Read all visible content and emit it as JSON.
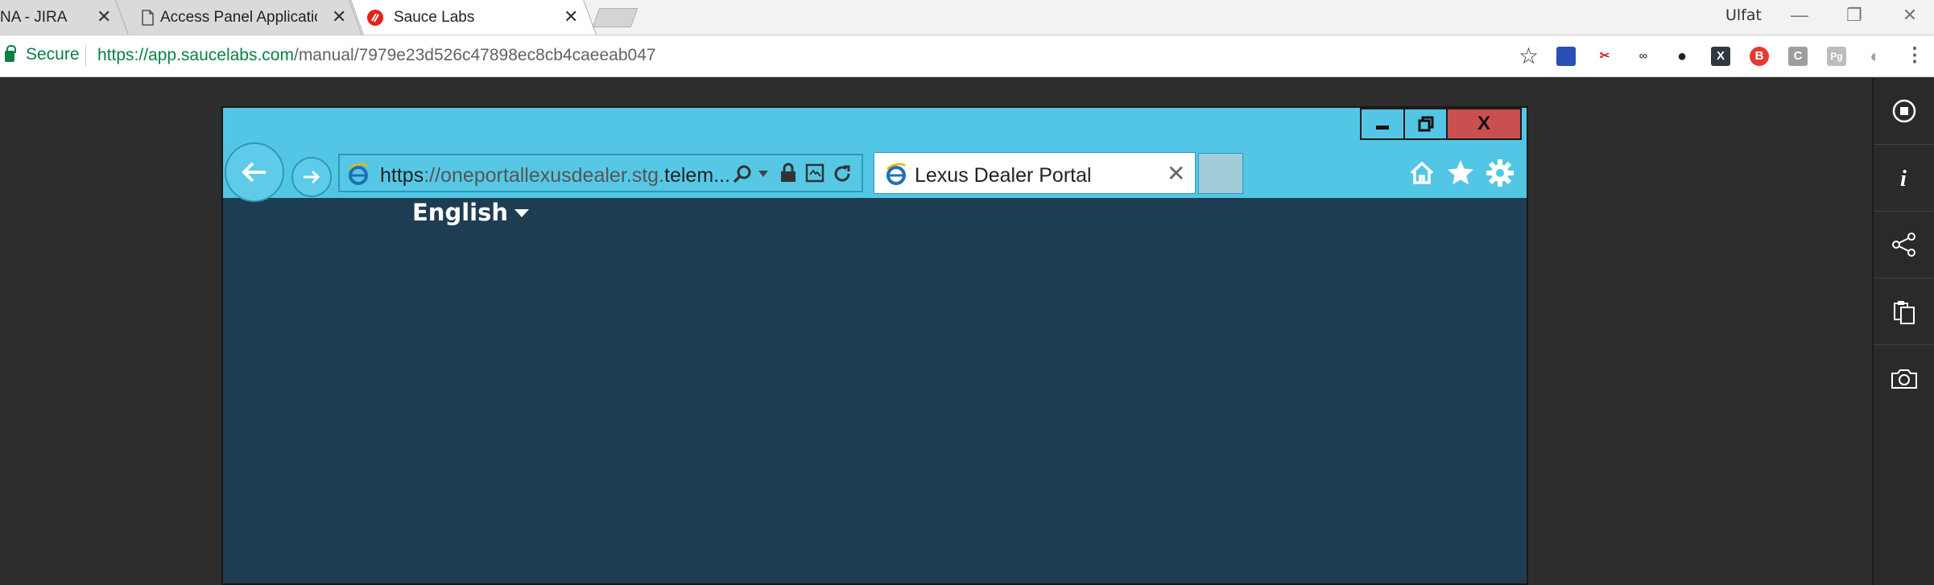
{
  "browser": {
    "tabs": [
      {
        "title": "NA - JIRA",
        "close": "✕"
      },
      {
        "title": "Access Panel Applications",
        "close": "✕"
      },
      {
        "title": "Sauce Labs",
        "close": "✕",
        "active": true
      }
    ],
    "user_name": "Ulfat",
    "window_controls": {
      "minimize": "—",
      "restore": "❐",
      "close": "✕"
    }
  },
  "address_bar": {
    "secure_label": "Secure",
    "url_host": "https://app.saucelabs.com",
    "url_path": "/manual/7979e23d526c47898ec8cb4caeeab047",
    "bookmark_icon": "star-icon"
  },
  "extensions": [
    {
      "name": "ext-blue-icon",
      "color": "#2b4fb8",
      "glyph": "⬛"
    },
    {
      "name": "ext-scissors-icon",
      "color": "#ffffff",
      "glyph": "✂"
    },
    {
      "name": "ext-glasses-icon",
      "color": "#ffffff",
      "glyph": "∞"
    },
    {
      "name": "ext-dark-circle-icon",
      "color": "#222222",
      "glyph": "●"
    },
    {
      "name": "ext-x-icon",
      "color": "#2e3a3f",
      "glyph": "X"
    },
    {
      "name": "ext-red-b-icon",
      "color": "#e53935",
      "glyph": "B"
    },
    {
      "name": "ext-c-icon",
      "color": "#9e9e9e",
      "glyph": "C"
    },
    {
      "name": "ext-pg-icon",
      "color": "#bdbdbd",
      "glyph": "Pg"
    },
    {
      "name": "ext-gray-circle-icon",
      "color": "#9e9e9e",
      "glyph": "◐"
    }
  ],
  "remote": {
    "ie": {
      "address_main": "https",
      "address_dim": "://oneportallexusdealer.stg.",
      "address_tail": "telem...",
      "tab_title": "Lexus Dealer Portal",
      "tab_close": "✕",
      "window_close": "X"
    },
    "page": {
      "language": "English"
    }
  },
  "sidepanel": {
    "items": [
      "stop-icon",
      "info-icon",
      "share-icon",
      "clipboard-icon",
      "camera-icon"
    ]
  },
  "colors": {
    "ie_frame": "#53c6e5",
    "page_bg": "#1e3d52",
    "ie_close": "#c9504f",
    "secure_green": "#0b8043"
  }
}
